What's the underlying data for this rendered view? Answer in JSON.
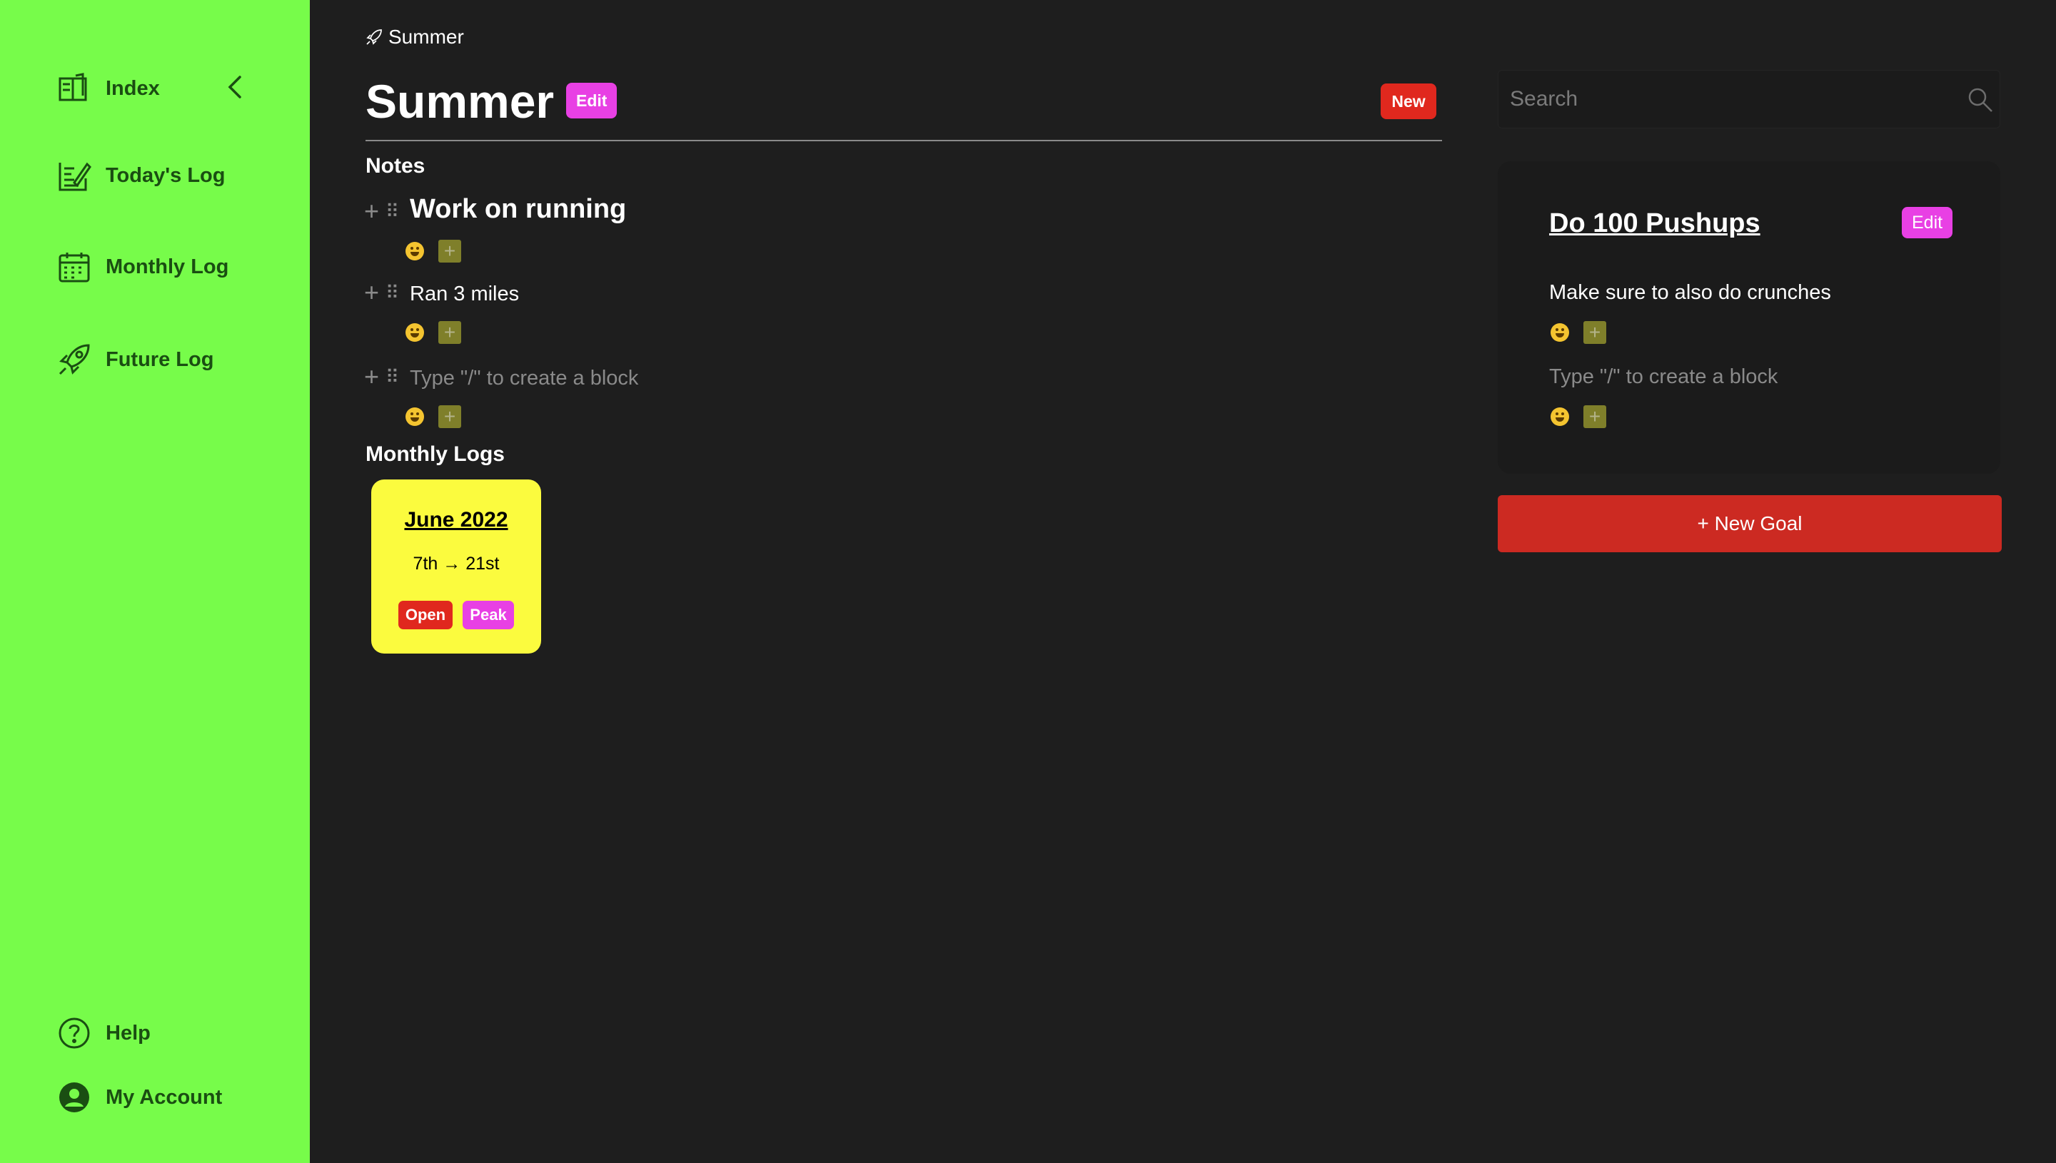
{
  "sidebar": {
    "items": [
      {
        "label": "Index",
        "icon": "book-icon"
      },
      {
        "label": "Today's Log",
        "icon": "notepad-icon"
      },
      {
        "label": "Monthly Log",
        "icon": "calendar-icon"
      },
      {
        "label": "Future Log",
        "icon": "rocket-icon"
      }
    ],
    "footer": [
      {
        "label": "Help",
        "icon": "help-icon"
      },
      {
        "label": "My Account",
        "icon": "account-icon"
      }
    ],
    "collapse_icon": "chevron-left-icon"
  },
  "breadcrumb": {
    "label": "Summer",
    "icon": "rocket-icon"
  },
  "page": {
    "title": "Summer",
    "edit_label": "Edit",
    "new_label": "New"
  },
  "notes": {
    "heading": "Notes",
    "blocks": [
      {
        "text": "Work on running",
        "style": "heading"
      },
      {
        "text": "Ran 3 miles",
        "style": "text"
      },
      {
        "placeholder": "Type \"/\" to create a block"
      }
    ],
    "reaction_emoji": "grinning-face-icon",
    "add_reaction_label": "+"
  },
  "monthly_logs": {
    "heading": "Monthly Logs",
    "cards": [
      {
        "title": "June 2022",
        "range": "7th → 21st",
        "open_label": "Open",
        "peak_label": "Peak"
      }
    ]
  },
  "search": {
    "placeholder": "Search"
  },
  "goal": {
    "title": "Do 100 Pushups",
    "edit_label": "Edit",
    "note": "Make sure to also do crunches",
    "placeholder": "Type \"/\" to create a block"
  },
  "new_goal_label": "+ New Goal",
  "colors": {
    "sidebar_bg": "#77fc4a",
    "sidebar_text": "#1a4e12",
    "page_bg": "#1e1e1e",
    "panel_bg": "#1b1b1b",
    "accent_magenta": "#e840e4",
    "accent_red": "#e0281e",
    "button_red": "#cc2a22",
    "card_yellow": "#fbfb3e"
  }
}
